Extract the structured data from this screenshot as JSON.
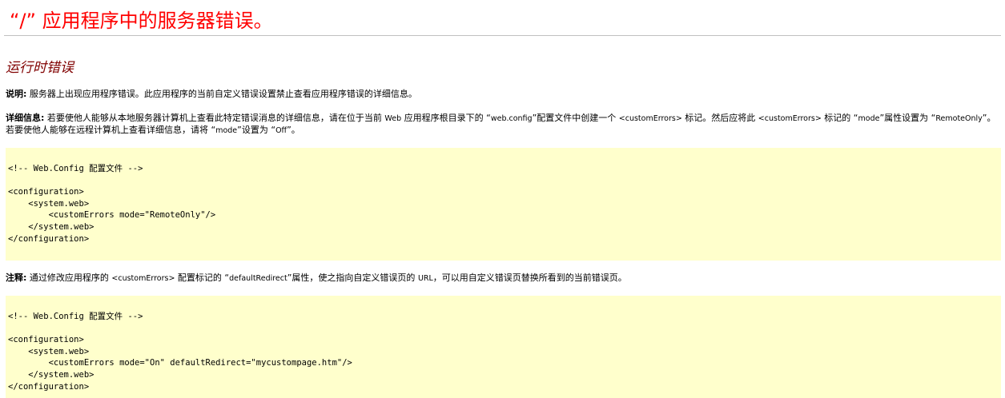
{
  "header": {
    "title": "“/” 应用程序中的服务器错误。",
    "subtitle": "运行时错误"
  },
  "description": {
    "label": "说明:",
    "text": " 服务器上出现应用程序错误。此应用程序的当前自定义错误设置禁止查看应用程序错误的详细信息。"
  },
  "details": {
    "label": "详细信息:",
    "t1": " 若要使他人能够从本地服务器计算机上查看此特定错误消息的详细信息，请在位于当前 ",
    "web": "Web",
    "t2": " 应用程序根目录下的 “",
    "webconfig": "web.config",
    "t3": "”配置文件中创建一个 ",
    "tag1": "<customErrors>",
    "t4": " 标记。然后应将此 ",
    "tag2": "<customErrors>",
    "t5": " 标记的 “",
    "mode": "mode",
    "t6": "”属性设置为 “",
    "remoteonly": "RemoteOnly",
    "t7": "”。若要使他人能够在远程计算机上查看详细信息，请将 “",
    "mode2": "mode",
    "t8": "”设置为 “",
    "off": "Off",
    "t9": "”。"
  },
  "code1": "<!-- Web.Config 配置文件 -->\n\n<configuration>\n    <system.web>\n        <customErrors mode=\"RemoteOnly\"/>\n    </system.web>\n</configuration>",
  "notes": {
    "label": "注释:",
    "t1": " 通过修改应用程序的 ",
    "tag": "<customErrors>",
    "t2": " 配置标记的 “",
    "attr": "defaultRedirect",
    "t3": "”属性，使之指向自定义错误页的 ",
    "url": "URL",
    "t4": "，可以用自定义错误页替换所看到的当前错误页。"
  },
  "code2": "<!-- Web.Config 配置文件 -->\n\n<configuration>\n    <system.web>\n        <customErrors mode=\"On\" defaultRedirect=\"mycustompage.htm\"/>\n    </system.web>\n</configuration>",
  "colors": {
    "title": "#ff0000",
    "subtitle": "#800000",
    "code_background": "#ffffcc"
  }
}
